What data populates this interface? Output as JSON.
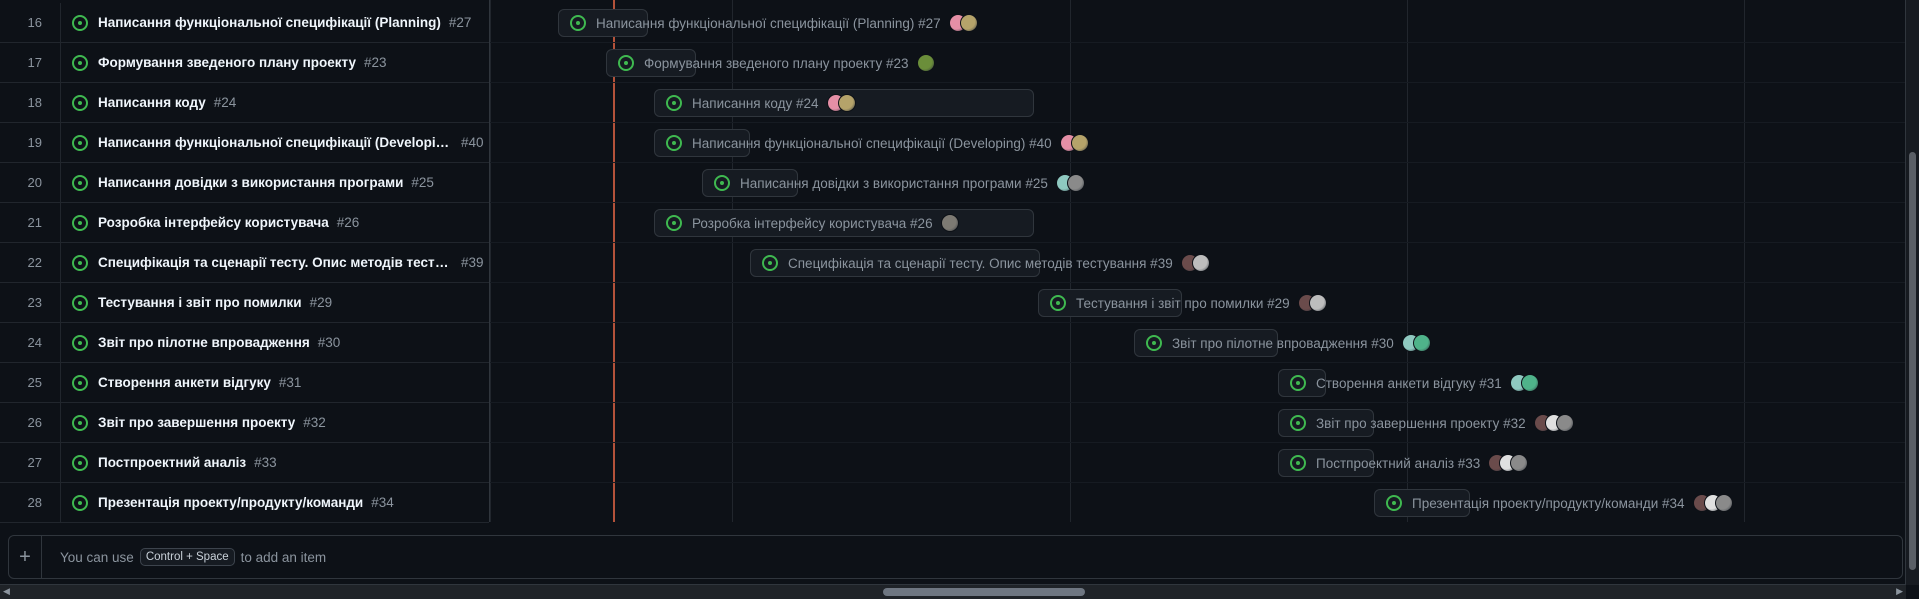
{
  "rows": [
    {
      "num": "16",
      "title": "Написання функціональної специфікації (Planning)",
      "ref": "#27"
    },
    {
      "num": "17",
      "title": "Формування зведеного плану проекту",
      "ref": "#23"
    },
    {
      "num": "18",
      "title": "Написання коду",
      "ref": "#24"
    },
    {
      "num": "19",
      "title": "Написання функціональної специфікації (Developing)",
      "ref": "#40"
    },
    {
      "num": "20",
      "title": "Написання довідки з використання програми",
      "ref": "#25"
    },
    {
      "num": "21",
      "title": "Розробка інтерфейсу користувача",
      "ref": "#26"
    },
    {
      "num": "22",
      "title": "Специфікація та сценарії тесту. Опис методів тестува...",
      "ref": "#39"
    },
    {
      "num": "23",
      "title": "Тестування і звіт про помилки",
      "ref": "#29"
    },
    {
      "num": "24",
      "title": "Звіт про пілотне впровадження",
      "ref": "#30"
    },
    {
      "num": "25",
      "title": "Створення анкети відгуку",
      "ref": "#31"
    },
    {
      "num": "26",
      "title": "Звіт про завершення проекту",
      "ref": "#32"
    },
    {
      "num": "27",
      "title": "Постпроектний аналіз",
      "ref": "#33"
    },
    {
      "num": "28",
      "title": "Презентація проекту/продукту/команди",
      "ref": "#34"
    }
  ],
  "timeline": [
    {
      "label": "Написання функціональної специфікації (Planning) #27",
      "avatars": [
        "#e58fa6",
        "#b5a36a"
      ]
    },
    {
      "label": "Формування зведеного плану проекту #23",
      "avatars": [
        "#6b8e3a"
      ]
    },
    {
      "label": "Написання коду #24",
      "avatars": [
        "#e58fa6",
        "#b5a36a"
      ]
    },
    {
      "label": "Написання функціональної специфікації (Developing) #40",
      "avatars": [
        "#e58fa6",
        "#b5a36a"
      ]
    },
    {
      "label": "Написання довідки з використання програми #25",
      "avatars": [
        "#8fc9c0",
        "#8a8a8a"
      ]
    },
    {
      "label": "Розробка інтерфейсу користувача #26",
      "avatars": [
        "#7d7a73"
      ]
    },
    {
      "label": "Специфікація та сценарії тесту. Опис методів тестування #39",
      "avatars": [
        "#6a4b4b",
        "#bdbdbd"
      ]
    },
    {
      "label": "Тестування і звіт про помилки #29",
      "avatars": [
        "#6a4b4b",
        "#bdbdbd"
      ]
    },
    {
      "label": "Звіт про пілотне впровадження #30",
      "avatars": [
        "#8fc9c0",
        "#4fb38a"
      ]
    },
    {
      "label": "Створення анкети відгуку #31",
      "avatars": [
        "#8fc9c0",
        "#4fb38a"
      ]
    },
    {
      "label": "Звіт про завершення проекту #32",
      "avatars": [
        "#6a4b4b",
        "#e0e0e0",
        "#8a8a8a"
      ]
    },
    {
      "label": "Постпроектний аналіз #33",
      "avatars": [
        "#6a4b4b",
        "#e0e0e0",
        "#8a8a8a"
      ]
    },
    {
      "label": "Презентація проекту/продукту/команди #34",
      "avatars": [
        "#6a4b4b",
        "#e0e0e0",
        "#8a8a8a"
      ]
    }
  ],
  "add_item": {
    "plus": "+",
    "prefix": "You can use",
    "shortcut": "Control + Space",
    "suffix": "to add an item"
  },
  "scroll": {
    "left_arrow": "◀",
    "right_arrow": "▶"
  },
  "colors": {
    "open_issue": "#3fb950",
    "today_marker": "#b3523a",
    "background": "#0d1117"
  },
  "icons": {
    "issue": "issue-open-icon",
    "add": "plus-icon"
  }
}
